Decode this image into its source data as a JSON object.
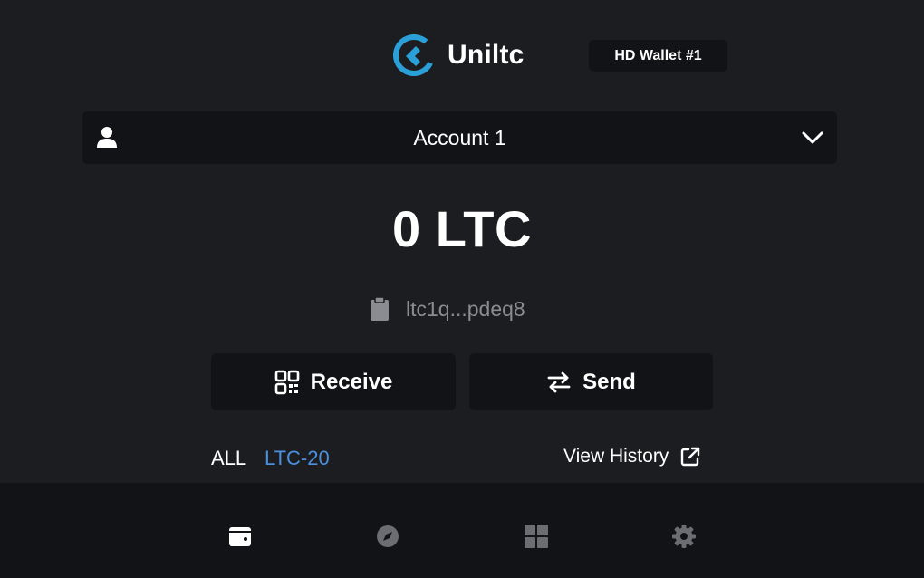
{
  "header": {
    "brand_name": "Uniltc",
    "wallet_label": "HD Wallet #1"
  },
  "account": {
    "name": "Account 1"
  },
  "balance": {
    "amount": "0 LTC"
  },
  "address": {
    "short": "ltc1q...pdeq8"
  },
  "actions": {
    "receive_label": "Receive",
    "send_label": "Send"
  },
  "tabs": {
    "all": "ALL",
    "ltc20": "LTC-20"
  },
  "history": {
    "label": "View History"
  },
  "nav": {
    "items": [
      {
        "icon": "wallet-icon",
        "active": true
      },
      {
        "icon": "compass-icon",
        "active": false
      },
      {
        "icon": "grid-icon",
        "active": false
      },
      {
        "icon": "gear-icon",
        "active": false
      }
    ]
  },
  "colors": {
    "background": "#1c1d20",
    "panel": "#121316",
    "accent": "#2a9fd8",
    "link": "#4b8fde",
    "muted": "#8a8c92",
    "inactive_icon": "#6b6d73"
  }
}
